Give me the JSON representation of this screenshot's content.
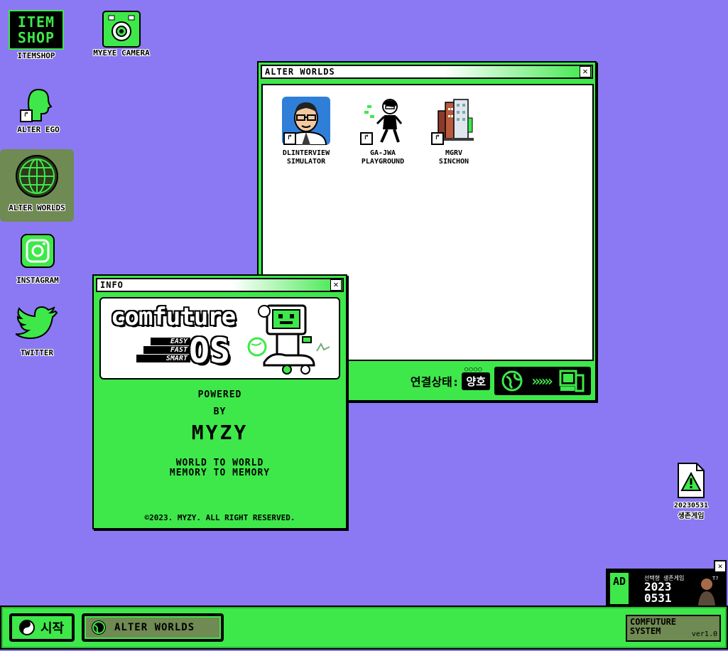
{
  "desktop": {
    "icons": [
      {
        "label": "ITEMSHOP",
        "logo_text_1": "ITEM",
        "logo_text_2": "SHOP"
      },
      {
        "label": "MYEYE CAMERA"
      },
      {
        "label": "ALTER EGO"
      },
      {
        "label": "ALTER WORLDS"
      },
      {
        "label": "INSTAGRAM"
      },
      {
        "label": "TWITTER"
      }
    ],
    "file": {
      "label_line1": "20230531",
      "label_line2": "생존게임"
    }
  },
  "alter_worlds_window": {
    "title": "ALTER WORLDS",
    "close": "✕",
    "items": [
      {
        "line1": "DLINTERVIEW",
        "line2": "SIMULATOR"
      },
      {
        "line1": "GA-JWA",
        "line2": "PLAYGROUND"
      },
      {
        "line1": "MGRV",
        "line2": "SINCHON"
      }
    ],
    "status_label": "연결상태:",
    "status_value": "양호",
    "status_dots": "○○○○"
  },
  "info_window": {
    "title": "INFO",
    "close": "✕",
    "logo_word": "comfuture",
    "logo_os": "OS",
    "taglines": [
      "EASY",
      "FAST",
      "SMART"
    ],
    "powered": "POWERED",
    "by": "BY",
    "brand": "MYZY",
    "slogan1": "WORLD TO WORLD",
    "slogan2": "MEMORY TO MEMORY",
    "copyright": "©2023. MYZY. ALL RIGHT RESERVED."
  },
  "ad": {
    "tag": "AD",
    "small": "선택형 생존게임",
    "year": "2023",
    "date": "0531",
    "close": "✕"
  },
  "taskbar": {
    "start_label": "시작",
    "task_label": "ALTER WORLDS",
    "system_line1": "COMFUTURE",
    "system_line2": "SYSTEM",
    "version": "ver1.0"
  },
  "colors": {
    "desktop": "#8a79f2",
    "accent": "#3ee84a",
    "selected": "#6f8a52"
  }
}
